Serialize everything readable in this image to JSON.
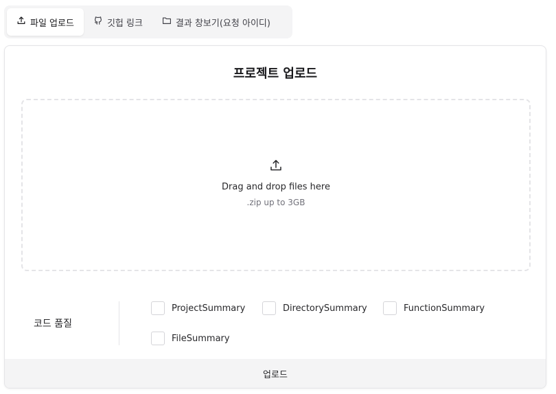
{
  "tabs": [
    {
      "label": "파일 업로드",
      "icon": "upload-icon",
      "active": true
    },
    {
      "label": "깃헙 링크",
      "icon": "github-icon",
      "active": false
    },
    {
      "label": "결과 창보기(요청 아이디)",
      "icon": "folder-icon",
      "active": false
    }
  ],
  "card": {
    "title": "프로젝트 업로드",
    "dropzone": {
      "icon": "upload-icon",
      "main_text": "Drag and drop files here",
      "sub_text": ".zip up to 3GB"
    },
    "quality": {
      "label": "코드 품질",
      "options": [
        "ProjectSummary",
        "DirectorySummary",
        "FunctionSummary",
        "FileSummary"
      ]
    },
    "submit_label": "업로드"
  }
}
